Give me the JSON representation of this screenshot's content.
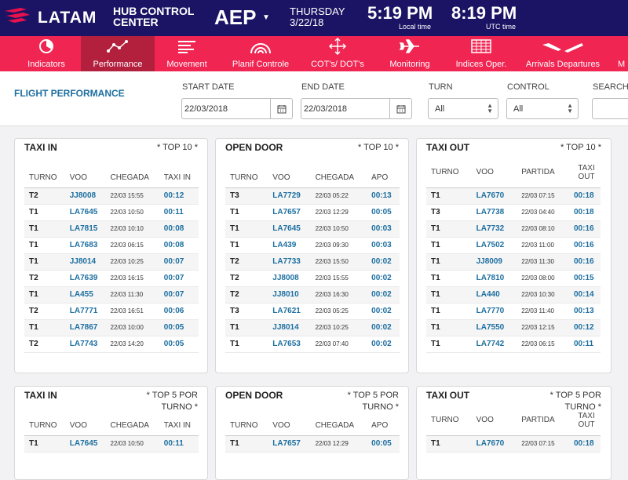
{
  "header": {
    "logo_text": "LATAM",
    "hub_title": "HUB CONTROL CENTER",
    "airport": "AEP",
    "day": "THURSDAY",
    "date": "3/22/18",
    "local_time": "5:19 PM",
    "local_label": "Local time",
    "utc_time": "8:19 PM",
    "utc_label": "UTC time"
  },
  "nav": [
    {
      "label": "Indicators",
      "icon": "pie-chart-icon"
    },
    {
      "label": "Performance",
      "icon": "line-chart-icon",
      "active": true
    },
    {
      "label": "Movement",
      "icon": "bars-icon"
    },
    {
      "label": "Planif Controle",
      "icon": "radar-icon"
    },
    {
      "label": "COT's/ DOT's",
      "icon": "arrows-icon"
    },
    {
      "label": "Monitoring",
      "icon": "plane-icon"
    },
    {
      "label": "Indices Oper.",
      "icon": "table-icon"
    },
    {
      "label": "Arrivals Departures",
      "icon": "plane-takeoff-icon"
    },
    {
      "label": "M",
      "icon": "more-icon"
    }
  ],
  "filters": {
    "page_title": "FLIGHT PERFORMANCE",
    "start_label": "START DATE",
    "start_value": "22/03/2018",
    "end_label": "END DATE",
    "end_value": "22/03/2018",
    "turn_label": "TURN",
    "turn_value": "All",
    "control_label": "CONTROL",
    "control_value": "All",
    "search_label": "SEARCH"
  },
  "cards": [
    {
      "title": "TAXI IN",
      "subtitle": "* TOP 10 *",
      "headers": [
        "TURNO",
        "VOO",
        "CHEGADA",
        "TAXI IN"
      ],
      "rows": [
        [
          "T2",
          "JJ8008",
          "22/03 15:55",
          "00:12"
        ],
        [
          "T1",
          "LA7645",
          "22/03 10:50",
          "00:11"
        ],
        [
          "T1",
          "LA7815",
          "22/03 10:10",
          "00:08"
        ],
        [
          "T1",
          "LA7683",
          "22/03 06:15",
          "00:08"
        ],
        [
          "T1",
          "JJ8014",
          "22/03 10:25",
          "00:07"
        ],
        [
          "T2",
          "LA7639",
          "22/03 16:15",
          "00:07"
        ],
        [
          "T1",
          "LA455",
          "22/03 11:30",
          "00:07"
        ],
        [
          "T2",
          "LA7771",
          "22/03 16:51",
          "00:06"
        ],
        [
          "T1",
          "LA7867",
          "22/03 10:00",
          "00:05"
        ],
        [
          "T2",
          "LA7743",
          "22/03 14:20",
          "00:05"
        ]
      ]
    },
    {
      "title": "OPEN DOOR",
      "subtitle": "* TOP 10 *",
      "headers": [
        "TURNO",
        "VOO",
        "CHEGADA",
        "APO"
      ],
      "rows": [
        [
          "T3",
          "LA7729",
          "22/03 05:22",
          "00:13"
        ],
        [
          "T1",
          "LA7657",
          "22/03 12:29",
          "00:05"
        ],
        [
          "T1",
          "LA7645",
          "22/03 10:50",
          "00:03"
        ],
        [
          "T1",
          "LA439",
          "22/03 09:30",
          "00:03"
        ],
        [
          "T2",
          "LA7733",
          "22/03 15:50",
          "00:02"
        ],
        [
          "T2",
          "JJ8008",
          "22/03 15:55",
          "00:02"
        ],
        [
          "T2",
          "JJ8010",
          "22/03 16:30",
          "00:02"
        ],
        [
          "T3",
          "LA7621",
          "22/03 05:25",
          "00:02"
        ],
        [
          "T1",
          "JJ8014",
          "22/03 10:25",
          "00:02"
        ],
        [
          "T1",
          "LA7653",
          "22/03 07:40",
          "00:02"
        ]
      ]
    },
    {
      "title": "TAXI OUT",
      "subtitle": "* TOP 10 *",
      "headers": [
        "TURNO",
        "VOO",
        "PARTIDA",
        "TAXI OUT"
      ],
      "rows": [
        [
          "T1",
          "LA7670",
          "22/03 07:15",
          "00:18"
        ],
        [
          "T3",
          "LA7738",
          "22/03 04:40",
          "00:18"
        ],
        [
          "T1",
          "LA7732",
          "22/03 08:10",
          "00:16"
        ],
        [
          "T1",
          "LA7502",
          "22/03 11:00",
          "00:16"
        ],
        [
          "T1",
          "JJ8009",
          "22/03 11:30",
          "00:16"
        ],
        [
          "T1",
          "LA7810",
          "22/03 08:00",
          "00:15"
        ],
        [
          "T1",
          "LA440",
          "22/03 10:30",
          "00:14"
        ],
        [
          "T1",
          "LA7770",
          "22/03 11:40",
          "00:13"
        ],
        [
          "T1",
          "LA7550",
          "22/03 12:15",
          "00:12"
        ],
        [
          "T1",
          "LA7742",
          "22/03 06:15",
          "00:11"
        ]
      ]
    },
    {
      "title": "TAXI IN",
      "subtitle": "* TOP 5 POR TURNO *",
      "headers": [
        "TURNO",
        "VOO",
        "CHEGADA",
        "TAXI IN"
      ],
      "rows": [
        [
          "T1",
          "LA7645",
          "22/03 10:50",
          "00:11"
        ]
      ]
    },
    {
      "title": "OPEN DOOR",
      "subtitle": "* TOP 5 POR TURNO *",
      "headers": [
        "TURNO",
        "VOO",
        "CHEGADA",
        "APO"
      ],
      "rows": [
        [
          "T1",
          "LA7657",
          "22/03 12:29",
          "00:05"
        ]
      ]
    },
    {
      "title": "TAXI OUT",
      "subtitle": "* TOP 5 POR TURNO *",
      "headers": [
        "TURNO",
        "VOO",
        "PARTIDA",
        "TAXI OUT"
      ],
      "rows": [
        [
          "T1",
          "LA7670",
          "22/03 07:15",
          "00:18"
        ]
      ]
    }
  ],
  "colors": {
    "topbar": "#1b1464",
    "navbar": "#f02552",
    "nav_active": "#b3203e",
    "link": "#1d6fa0"
  }
}
